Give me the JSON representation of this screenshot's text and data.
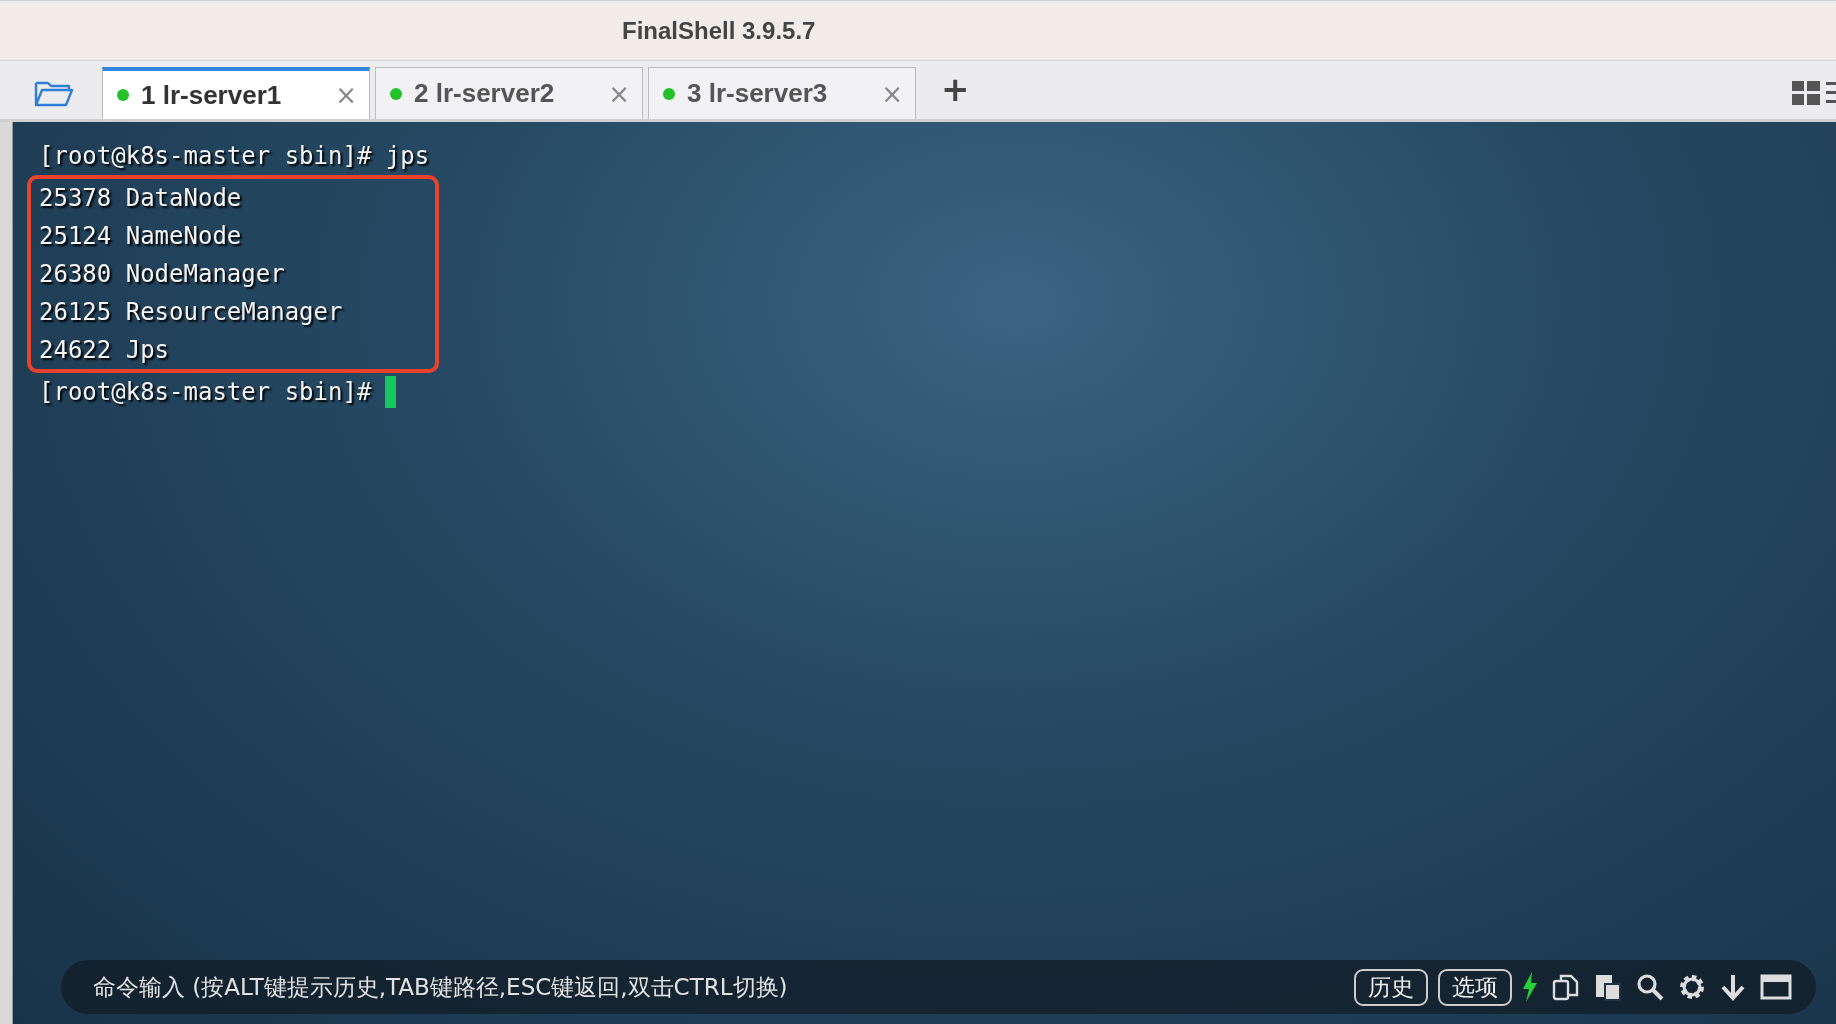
{
  "window": {
    "title": "FinalShell 3.9.5.7"
  },
  "tabs": [
    {
      "number": "1",
      "label": "lr-server1",
      "selected": true,
      "color": "#22c32a",
      "close": "×"
    },
    {
      "number": "2",
      "label": "lr-server2",
      "selected": false,
      "color": "#22c32a",
      "close": "×"
    },
    {
      "number": "3",
      "label": "lr-server3",
      "selected": false,
      "color": "#22c32a",
      "close": "×"
    }
  ],
  "new_tab": "+",
  "terminal": {
    "blocks": [
      {
        "kind": "line",
        "text": "[root@k8s-master sbin]# jps"
      },
      {
        "kind": "highlight",
        "lines": [
          "25378 DataNode",
          "25124 NameNode",
          "26380 NodeManager",
          "26125 ResourceManager",
          "24622 Jps"
        ]
      },
      {
        "kind": "prompt",
        "text": "[root@k8s-master sbin]#",
        "cursor": true
      }
    ]
  },
  "command_bar": {
    "placeholder": "命令输入 (按ALT键提示历史,TAB键路径,ESC键返回,双击CTRL切换)",
    "buttons": [
      "历史",
      "选项"
    ]
  }
}
